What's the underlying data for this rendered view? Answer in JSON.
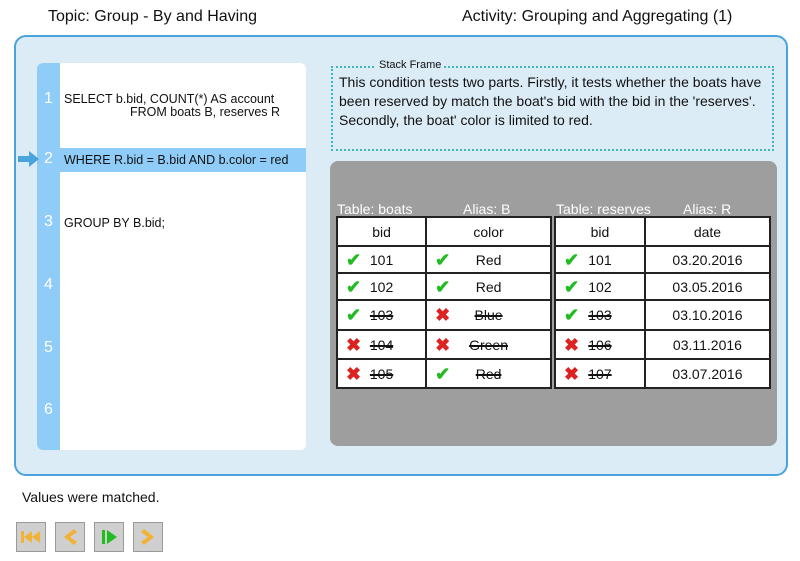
{
  "header": {
    "topic": "Topic: Group - By and Having",
    "activity": "Activity: Grouping and Aggregating (1)"
  },
  "code": {
    "lines": [
      {
        "num": "1",
        "text": "SELECT b.bid, COUNT(*) AS account",
        "cont": "FROM boats B, reserves R"
      },
      {
        "num": "2",
        "text": "WHERE R.bid = B.bid AND b.color = red"
      },
      {
        "num": "3",
        "text": "GROUP BY B.bid;"
      },
      {
        "num": "4",
        "text": ""
      },
      {
        "num": "5",
        "text": ""
      },
      {
        "num": "6",
        "text": ""
      }
    ],
    "current_line": 2
  },
  "stack_frame": {
    "title": "Stack Frame",
    "text": "This condition tests two parts. Firstly, it tests whether the boats have been reserved by match the boat's bid with the bid in the 'reserves'. Secondly, the boat' color is limited to red."
  },
  "tables": {
    "boats": {
      "label": "Table: boats",
      "alias": "Alias: B",
      "columns": [
        "bid",
        "color"
      ],
      "rows": [
        [
          {
            "value": "101",
            "mark": "check",
            "struck": false
          },
          {
            "value": "Red",
            "mark": "check",
            "struck": false
          }
        ],
        [
          {
            "value": "102",
            "mark": "check",
            "struck": false
          },
          {
            "value": "Red",
            "mark": "check",
            "struck": false
          }
        ],
        [
          {
            "value": "103",
            "mark": "check",
            "struck": true
          },
          {
            "value": "Blue",
            "mark": "cross",
            "struck": true
          }
        ],
        [
          {
            "value": "104",
            "mark": "cross",
            "struck": true
          },
          {
            "value": "Green",
            "mark": "cross",
            "struck": true
          }
        ],
        [
          {
            "value": "105",
            "mark": "cross",
            "struck": true
          },
          {
            "value": "Red",
            "mark": "check",
            "struck": true
          }
        ]
      ]
    },
    "reserves": {
      "label": "Table: reserves",
      "alias": "Alias: R",
      "columns": [
        "bid",
        "date"
      ],
      "rows": [
        [
          {
            "value": "101",
            "mark": "check",
            "struck": false
          },
          {
            "value": "03.20.2016",
            "mark": "",
            "struck": false
          }
        ],
        [
          {
            "value": "102",
            "mark": "check",
            "struck": false
          },
          {
            "value": "03.05.2016",
            "mark": "",
            "struck": false
          }
        ],
        [
          {
            "value": "103",
            "mark": "check",
            "struck": true
          },
          {
            "value": "03.10.2016",
            "mark": "",
            "struck": false
          }
        ],
        [
          {
            "value": "106",
            "mark": "cross",
            "struck": true
          },
          {
            "value": "03.11.2016",
            "mark": "",
            "struck": false
          }
        ],
        [
          {
            "value": "107",
            "mark": "cross",
            "struck": true
          },
          {
            "value": "03.07.2016",
            "mark": "",
            "struck": false
          }
        ]
      ]
    }
  },
  "status": "Values were matched.",
  "controls": {
    "icons": [
      "skip-to-start-icon",
      "step-back-icon",
      "play-icon",
      "step-forward-icon"
    ],
    "colors": {
      "button_bg": "#cfcfcf",
      "arrow": "#f2b233",
      "play": "#22bb22"
    }
  },
  "colors": {
    "accent": "#4aa3dc",
    "highlight": "#8fcdf8",
    "check": "#22bb22",
    "cross": "#dd2222",
    "panel_bg": "#dcecf7",
    "tables_bg": "#9e9e9e"
  }
}
